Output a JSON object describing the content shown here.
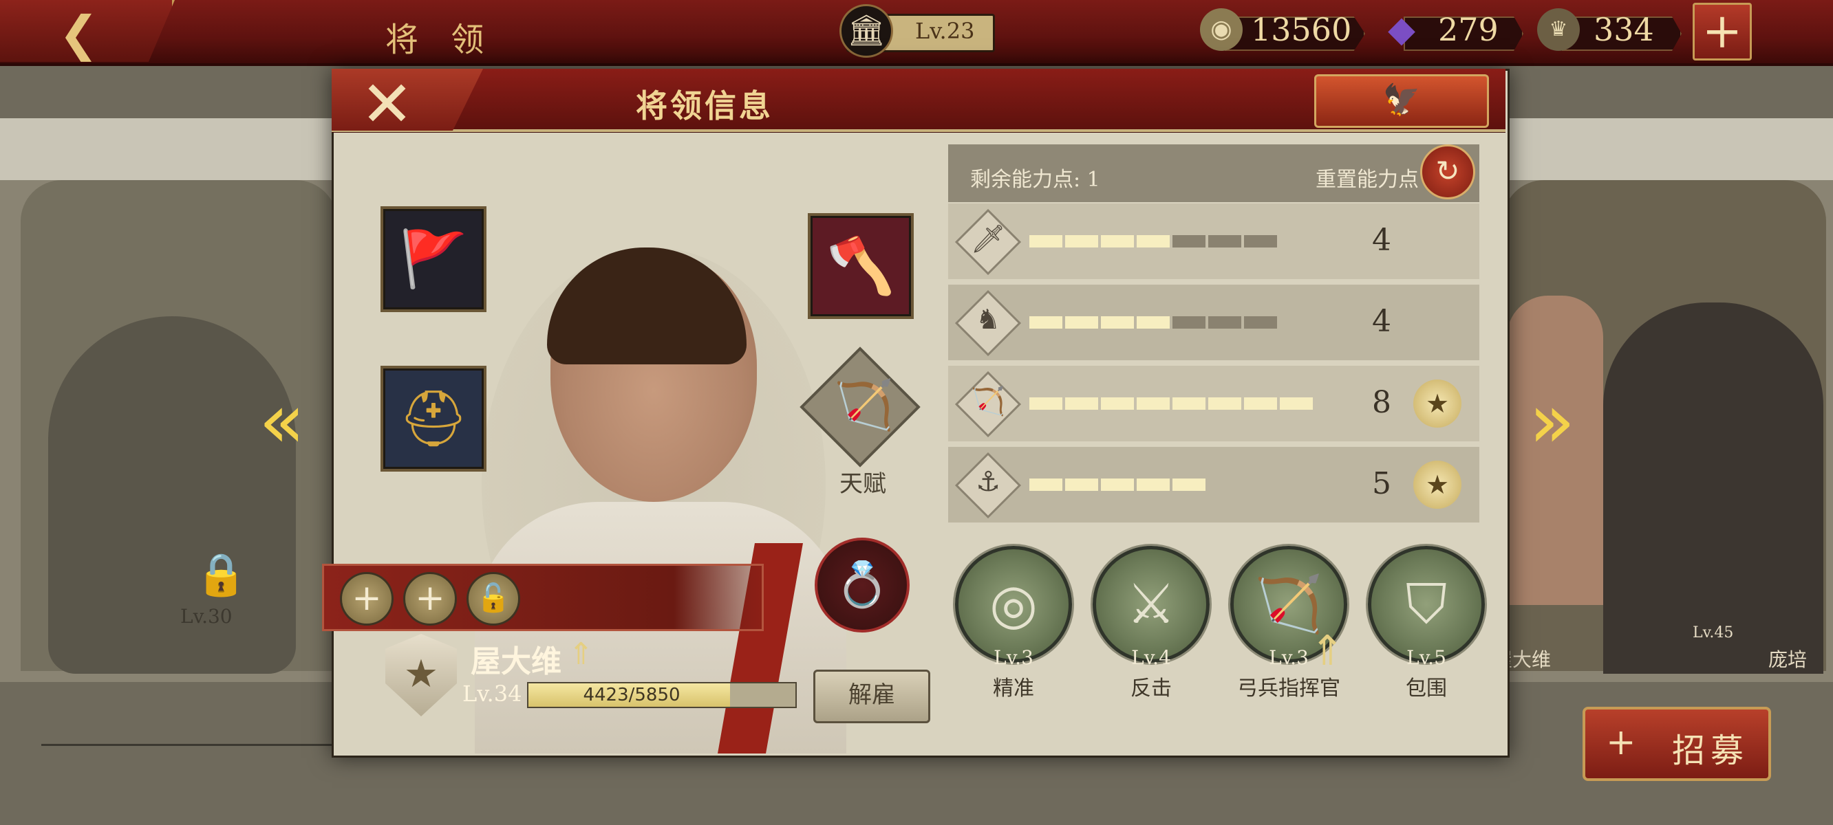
{
  "topbar": {
    "back_icon": "chevron-left-icon",
    "title": "将 领",
    "level_label": "Lv.23",
    "coins": "13560",
    "gems": "279",
    "spqr": "334",
    "plus_label": "+"
  },
  "background": {
    "left_lv": "Lv.30",
    "right_name_1": "屋大维",
    "right_name_2": "庞培",
    "right_lv": "Lv.45",
    "prev_arrow": "«",
    "next_arrow": "»"
  },
  "recruit": {
    "label": "招募",
    "icon": "+"
  },
  "dialog": {
    "close_label": "✕",
    "title": "将领信息",
    "eagle_icon": "🦅"
  },
  "general": {
    "name": "屋大维",
    "up_icon": "⇑",
    "level": "Lv.34",
    "xp_text": "4423/5850",
    "xp_current": 4423,
    "xp_max": 5850,
    "dismiss_label": "解雇",
    "talent_label": "天赋",
    "talent_glyph": "🏹",
    "rank_glyph": "★",
    "slots": [
      "+",
      "+",
      "🔓"
    ]
  },
  "equipment": {
    "banner_glyph": "🚩",
    "helmet_glyph": "⛑",
    "axe_glyph": "🪓",
    "ring_glyph": "💍"
  },
  "abilities": {
    "remaining_label": "剩余能力点: 1",
    "reset_label": "重置能力点",
    "reset_icon": "↻",
    "stats": [
      {
        "glyph": "🗡",
        "value": "4",
        "filled": 4,
        "total": 7,
        "badge": false
      },
      {
        "glyph": "♞",
        "value": "4",
        "filled": 4,
        "total": 7,
        "badge": false
      },
      {
        "glyph": "🏹",
        "value": "8",
        "filled": 8,
        "total": 8,
        "badge": true
      },
      {
        "glyph": "⚓",
        "value": "5",
        "filled": 5,
        "total": 5,
        "badge": true
      }
    ],
    "badge_glyph": "★"
  },
  "skills": [
    {
      "name": "精准",
      "level": "Lv.3",
      "glyph": "◎"
    },
    {
      "name": "反击",
      "level": "Lv.4",
      "glyph": "⚔"
    },
    {
      "name": "弓兵指挥官",
      "level": "Lv.3",
      "glyph": "🏹"
    },
    {
      "name": "包围",
      "level": "Lv.5",
      "glyph": "⛉"
    }
  ],
  "skill_up_icon": "⇑"
}
